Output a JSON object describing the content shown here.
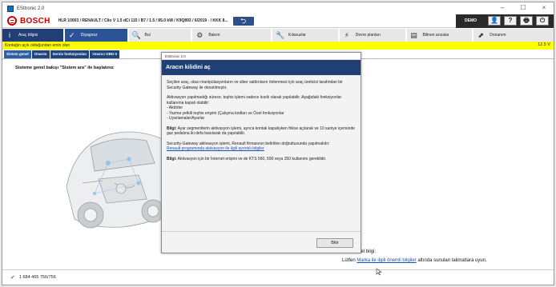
{
  "window": {
    "title": "ESItronic 2.0",
    "controls": {
      "minimize": "–",
      "maximize": "☐",
      "close": "×"
    }
  },
  "header": {
    "brand": "BOSCH",
    "vehicle": "HLR 10003 / RENAULT / Clio V 1.5 dCi 115 / B7 / 1.5 / 85.0 kW / K9Q893 / 6/2019 - / KKK 8...",
    "back_glyph": "⮌",
    "demo": "DEMO",
    "buttons": {
      "user": "👤",
      "help": "?",
      "print": "🖶",
      "exit": "⏻"
    }
  },
  "nav": {
    "tabs": [
      {
        "label": "Araç bilgisi",
        "icon": "i"
      },
      {
        "label": "Diyagnoz",
        "icon": "✓"
      },
      {
        "label": "Bul",
        "icon": "🔍"
      },
      {
        "label": "Bakım",
        "icon": "⚙"
      },
      {
        "label": "Kılavuzlar",
        "icon": "🔧"
      },
      {
        "label": "Devre planları",
        "icon": "⚡"
      },
      {
        "label": "Bilinen arızalar",
        "icon": "▤"
      },
      {
        "label": "Donanım",
        "icon": "⬈"
      }
    ]
  },
  "warning": {
    "text": "Kontağın açık olduğundan emin olun",
    "voltage": "12.5 V"
  },
  "subtabs": [
    "Sistem genel",
    "Onarım",
    "Servis fonksiyonları",
    "Onarıcı OBD II"
  ],
  "main": {
    "heading": "Sisteme genel bakışı \"Sistem ara\" ile başlatınız",
    "info_title": "Genel bilgi:",
    "info_prefix": "Lütfen ",
    "info_link": "Marka ile ilgili önemli bilgiler",
    "info_suffix": " altında sunulan talimatlara uyun."
  },
  "status": {
    "number": "1 684 465 756/756"
  },
  "dialog": {
    "window_title": "ESItronic 2.0",
    "header": "Aracın kilidini aç",
    "p1": "Seçilen araç, olası manipülasyonların ve siber saldırıların önlenmesi için araç üreticisi tarafından bir Security Gateway ile donatılmıştır.",
    "p2_intro": "Aktivasyon yapılmadığı sürece, teşhis işlemi sadece kısıtlı olarak yapılabilir. Aşağıdaki fonksiyonlar kullanıma kapalı olabilir:",
    "p2_list": [
      "- Aktörler",
      "- Yazma yetkili teşhis erişimi (Çalışma kodları ve Özel fonksiyonlar",
      "- Uyarlamalar/Ayarlar"
    ],
    "p3_label": "Bilgi:",
    "p3_text": " Ayar segmentlerin aktivasyon işlemi, ayrıca kontak kapalıyken frikse açılarak ve 10 saniye içerisinde gaz pedalına iki defa basılarak da yapılabilir.",
    "p4_text": "Security-Gateway aktivasyon işlemi, Renault firmasının belirtilen doğrultusunda yapılmalıdır:",
    "p4_link": "Renault programında aktivasyon ile ilgili ayrıntılı bilgiler",
    "p5_label": "Bilgi:",
    "p5_text": " Aktivasyon için bir İnternet erişimi ve de KTS 560, 590 veya 350 kullanımı gereklidir.",
    "ok_label": "Bitir"
  }
}
